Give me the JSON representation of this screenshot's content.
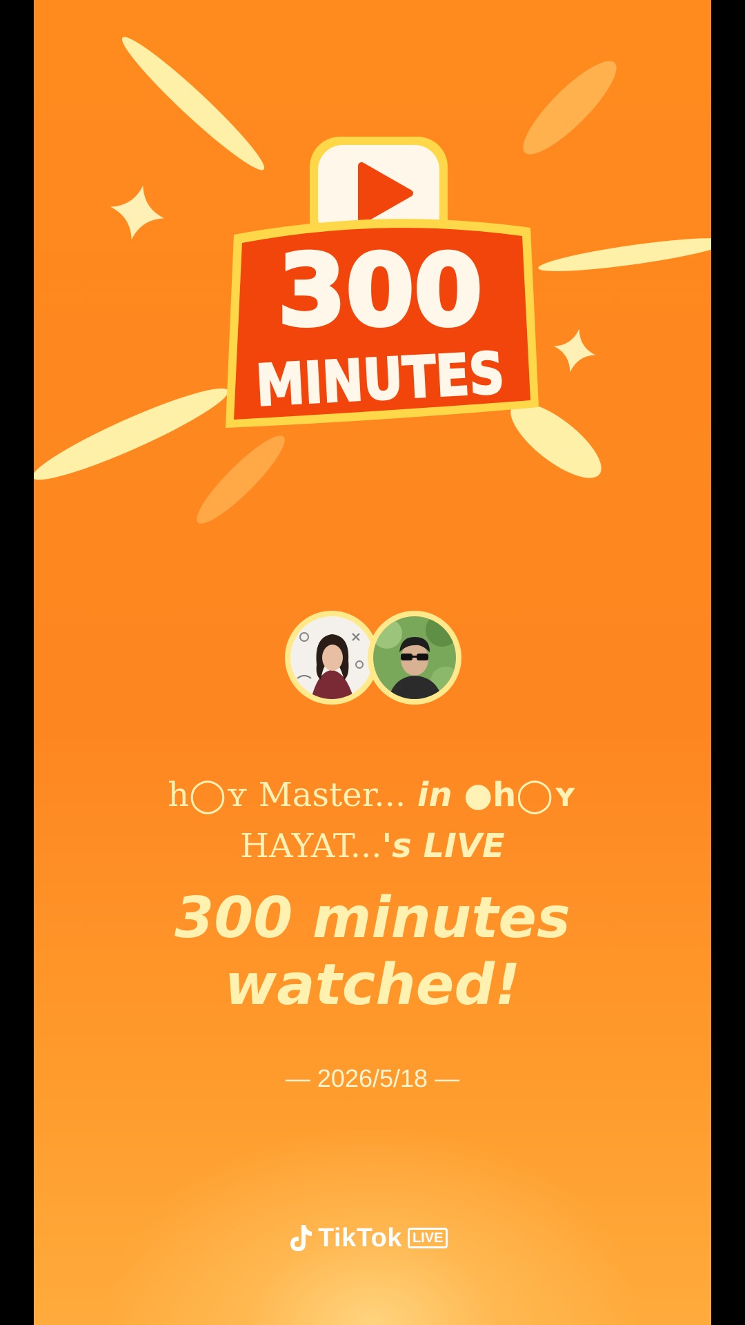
{
  "badge": {
    "number": "300",
    "unit": "MINUTES",
    "play_icon": "play-icon"
  },
  "hosts": {
    "line1_name1": "h◯ʏ Master...",
    "line1_in": "in",
    "line1_name2": "●h◯ʏ",
    "line2_name2": "HAYAT...",
    "line2_suffix": "'s LIVE"
  },
  "headline": {
    "line1": "300 minutes",
    "line2": "watched!"
  },
  "date": "— 2026/5/18 —",
  "brand": {
    "icon": "tiktok-note-icon",
    "name": "TikTok",
    "tag": "LIVE"
  },
  "colors": {
    "background": "#fe8621",
    "text_cream": "#fff1b0",
    "badge_red": "#f2450c",
    "badge_yellow": "#ffd84a"
  }
}
